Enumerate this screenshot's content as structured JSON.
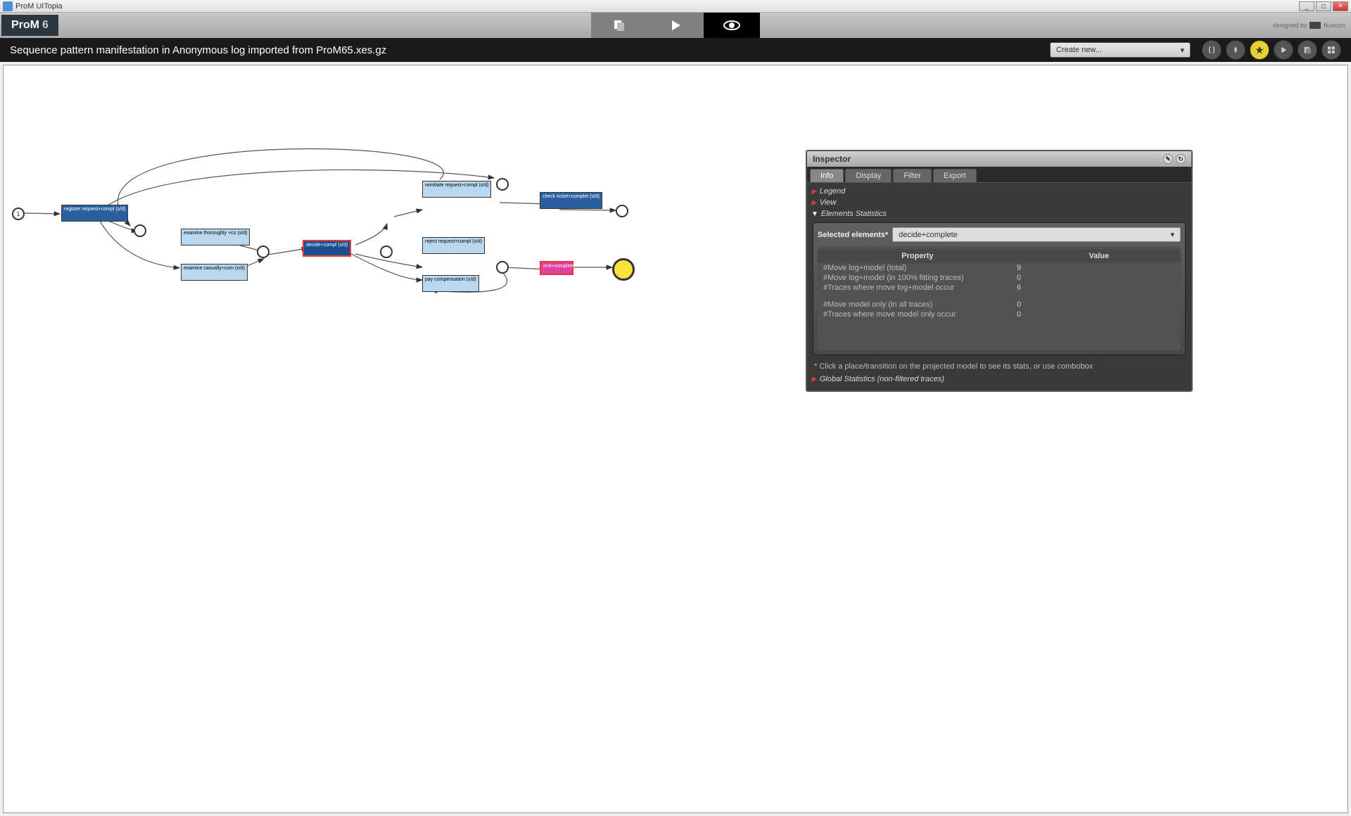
{
  "titlebar": {
    "app_name": "ProM UITopia"
  },
  "logo": {
    "text": "ProM",
    "version": "6"
  },
  "designed_by": {
    "label": "designed by",
    "brand": "fluxicon"
  },
  "subheader": {
    "title": "Sequence pattern manifestation in Anonymous log imported from ProM65.xes.gz",
    "create_new": "Create new..."
  },
  "petri": {
    "start_token": "1",
    "nodes": {
      "register": "register request+compl (s/d)",
      "examine_thorough": "examine thoroughly +co (s/d)",
      "examine_casual": "examine casually+com (s/d)",
      "decide": "decide+compl (s/d)",
      "reinitiate": "reinitiate request+compl (s/d)",
      "check_ticket": "check ticket+complet (s/d)",
      "reject": "reject request+compl (s/d)",
      "pay_comp": "pay compensation (s/d)",
      "end": "end+complete"
    }
  },
  "inspector": {
    "title": "Inspector",
    "tabs": {
      "info": "Info",
      "display": "Display",
      "filter": "Filter",
      "export": "Export"
    },
    "sections": {
      "legend": "Legend",
      "view": "View",
      "elem_stats": "Elements Statistics",
      "global": "Global Statistics (non-filtered traces)"
    },
    "selected_label": "Selected elements*",
    "selected_value": "decide+complete",
    "thead": {
      "prop": "Property",
      "val": "Value"
    },
    "rows": [
      {
        "p": "#Move log+model (total)",
        "v": "9"
      },
      {
        "p": "#Move log+model (in 100% fitting traces)",
        "v": "0"
      },
      {
        "p": "#Traces where move log+model occur",
        "v": "6"
      },
      {
        "p": "",
        "v": ""
      },
      {
        "p": "#Move model only (in all traces)",
        "v": "0"
      },
      {
        "p": "#Traces where move model only occur",
        "v": "0"
      }
    ],
    "hint": "* Click a place/transition on the projected model to see its stats, or use combobox"
  }
}
